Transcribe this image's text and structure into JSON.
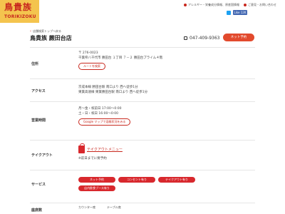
{
  "header": {
    "logo_jp": "鳥貴族",
    "logo_en": "TORIKIZOKU",
    "links": [
      "アレルギー・栄養成分情報、原産国情報",
      "ご意見・お問い合わせ"
    ],
    "fb_like": "Like 12K"
  },
  "breadcrumb": "店舗検索トップへ戻る",
  "title": "鳥貴族 蕨田台店",
  "phone": "047-409-9363",
  "reserve_label": "ネット予約",
  "address": {
    "label": "住所",
    "postal": "〒 276-0023",
    "line": "千葉県八千代市 勝田台 １丁目 ７－２ 勝田台プライム４階",
    "route_btn": "ルートを検索"
  },
  "access": {
    "label": "アクセス",
    "lines": [
      "京成本線 勝田台駅 南口より 西へ徒歩1分",
      "東葉高速線 東葉勝田台駅 南口より 西へ徒歩1分"
    ]
  },
  "hours": {
    "label": "営業時間",
    "lines": [
      "月～金・祝前日 17:00～0:00",
      "土・日・祝日 16:00～0:00"
    ],
    "map_btn": "Google マップで混雑状況をみる"
  },
  "takeout": {
    "label": "テイクアウト",
    "link": "テイクアウトメニュー",
    "note": "※前日までに要予約"
  },
  "services": {
    "label": "サービス",
    "items": [
      "ネット予約",
      "コンセント有り",
      "テイクアウト有り",
      "店内飲食ブース有り"
    ]
  },
  "seats": {
    "label": "座席数",
    "cols": [
      "カウンター席",
      "テーブル席"
    ]
  },
  "colors": {
    "brand_red": "#c8281e",
    "logo_yellow": "#f4c44e",
    "accent_orange": "#e24a2d"
  }
}
